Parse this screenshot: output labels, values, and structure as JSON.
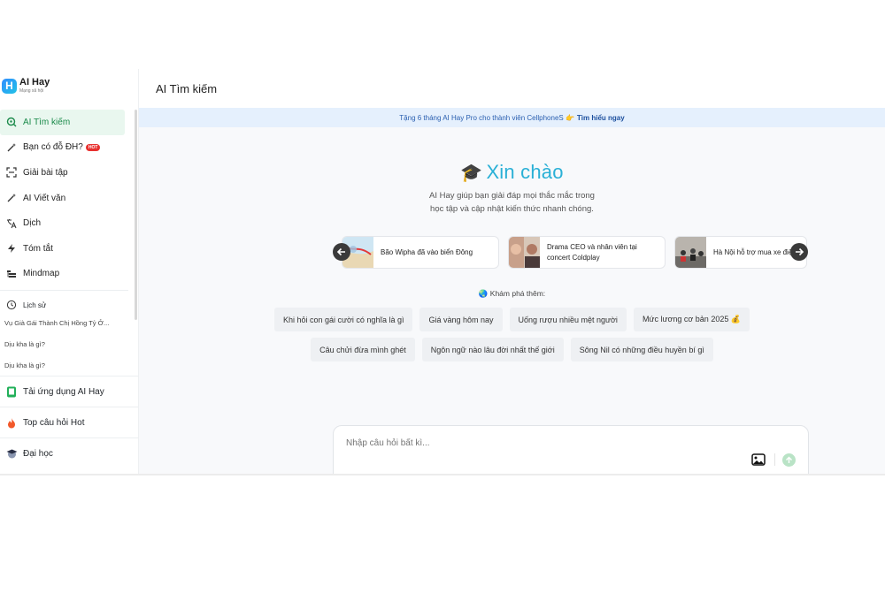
{
  "app": {
    "name": "AI Hay",
    "tagline": "Mạng xã hội",
    "logo_letter": "H"
  },
  "sidebar": {
    "items": [
      {
        "label": "AI Tìm kiếm",
        "icon": "search-icon",
        "active": true
      },
      {
        "label": "Bạn có đỗ ĐH?",
        "icon": "magic-wand-icon",
        "badge": "HOT"
      },
      {
        "label": "Giải bài tập",
        "icon": "scan-icon"
      },
      {
        "label": "AI Viết văn",
        "icon": "magic-wand-icon"
      },
      {
        "label": "Dịch",
        "icon": "translate-icon"
      },
      {
        "label": "Tóm tắt",
        "icon": "lightning-icon"
      },
      {
        "label": "Mindmap",
        "icon": "mindmap-icon"
      }
    ],
    "history": {
      "title": "Lịch sử",
      "items": [
        "Vụ Già Gái Thành Chị Hồng Tỷ Ở...",
        "Dịu kha là gì?",
        "Dịu kha là gì?"
      ]
    },
    "bottom": [
      {
        "label": "Tải ứng dụng AI Hay",
        "icon": "phone-icon"
      },
      {
        "label": "Top câu hỏi Hot",
        "icon": "fire-icon"
      },
      {
        "label": "Đại học",
        "icon": "graduation-cap-icon"
      }
    ]
  },
  "header": {
    "title": "AI Tìm kiếm"
  },
  "banner": {
    "text": "Tặng 6 tháng AI Hay Pro cho thành viên CellphoneS 👉",
    "link": "Tìm hiểu ngay"
  },
  "hero": {
    "emoji": "🎓",
    "title": "Xin chào",
    "subtitle_line1": "AI Hay giúp bạn giải đáp mọi thắc mắc trong",
    "subtitle_line2": "học tập và cập nhật kiến thức nhanh chóng."
  },
  "news": [
    {
      "title": "Bão Wipha đã vào biển Đông"
    },
    {
      "title_line1": "Drama CEO và nhân viên tại",
      "title_line2": "concert Coldplay"
    },
    {
      "title": "Hà Nội hỗ trợ mua xe điện"
    }
  ],
  "explore": {
    "label": "🌏 Khám phá thêm:",
    "row1": [
      "Khi hỏi con gái cười có nghĩa là gì",
      "Giá vàng hôm nay",
      "Uống rượu nhiều mệt người",
      "Mức lương cơ bản 2025 💰"
    ],
    "row2": [
      "Câu chửi đừa mình ghét",
      "Ngôn ngữ nào lâu đời nhất thế giới",
      "Sông Nil có những điều huyền bí gì"
    ]
  },
  "composer": {
    "placeholder": "Nhập câu hỏi bất kì..."
  },
  "colors": {
    "accent": "#2ab0d6",
    "active_bg": "#e9f7ef",
    "active_text": "#1a8a4a",
    "banner_bg": "#e5f0fd",
    "hot": "#e8312f"
  }
}
